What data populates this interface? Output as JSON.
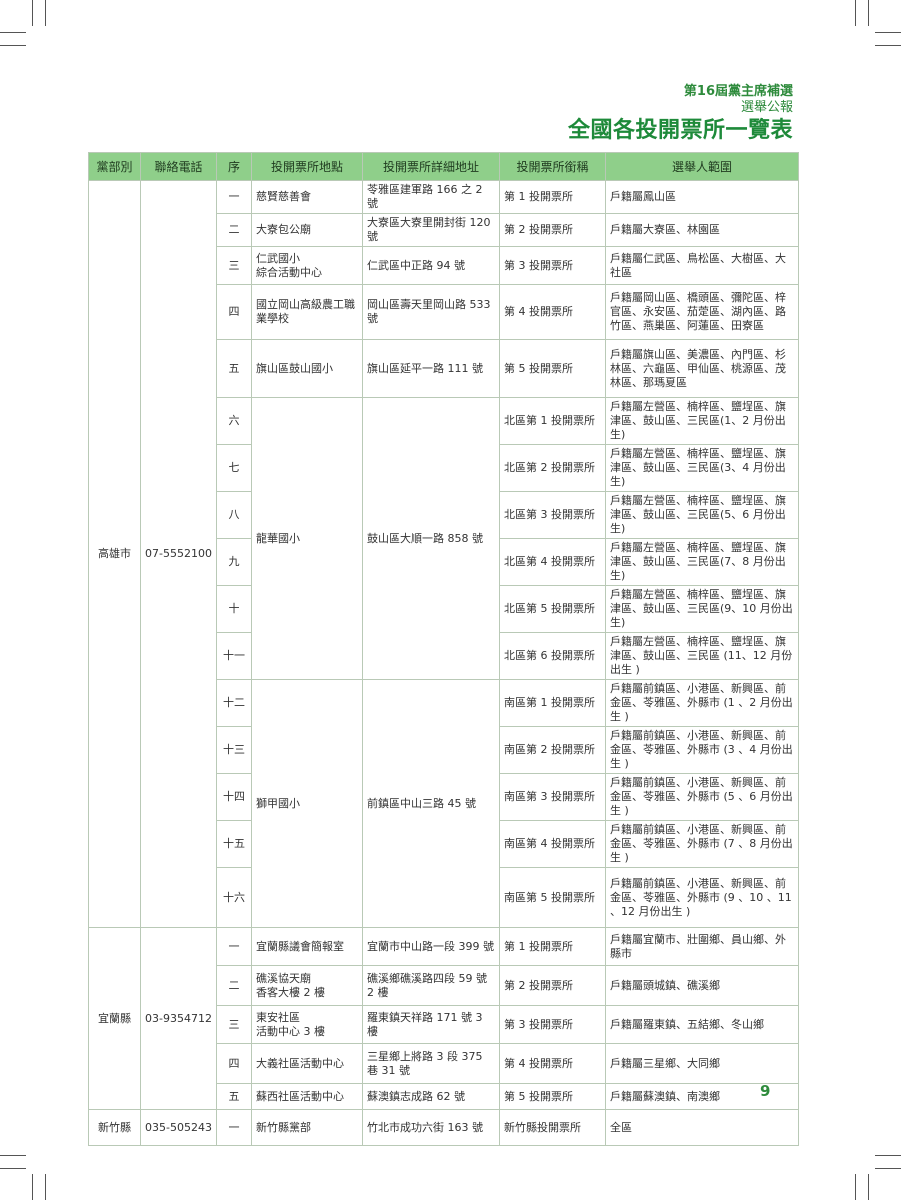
{
  "header": {
    "line1": "第16屆黨主席補選",
    "line2": "選舉公報",
    "title": "全國各投開票所一覽表"
  },
  "table": {
    "columns": [
      "黨部別",
      "聯絡電話",
      "序",
      "投開票所地點",
      "投開票所詳細地址",
      "投開票所銜稱",
      "選舉人範圍"
    ],
    "groups": [
      {
        "party": "高雄市",
        "phone": "07-5552100",
        "rows": [
          {
            "seq": "一",
            "location": "慈賢慈善會",
            "address": "苓雅區建軍路 166 之 2 號",
            "station": "第 1 投開票所",
            "scope": "戶籍屬鳳山區"
          },
          {
            "seq": "二",
            "location": "大寮包公廟",
            "address": "大寮區大寮里開封街 120 號",
            "station": "第 2 投開票所",
            "scope": "戶籍屬大寮區、林園區"
          },
          {
            "seq": "三",
            "location": "仁武國小\n綜合活動中心",
            "address": "仁武區中正路 94 號",
            "station": "第 3 投開票所",
            "scope": "戶籍屬仁武區、鳥松區、大樹區、大社區"
          },
          {
            "seq": "四",
            "location": "國立岡山高級農工職業學校",
            "address": "岡山區壽天里岡山路 533 號",
            "station": "第 4 投開票所",
            "scope": "戶籍屬岡山區、橋頭區、彌陀區、梓官區、永安區、茄萣區、湖內區、路竹區、燕巢區、阿蓮區、田寮區"
          },
          {
            "seq": "五",
            "location": "旗山區鼓山國小",
            "address": "旗山區延平一路 111 號",
            "station": "第 5 投開票所",
            "scope": "戶籍屬旗山區、美濃區、內門區、杉林區、六龜區、甲仙區、桃源區、茂林區、那瑪夏區"
          },
          {
            "seq": "六",
            "station": "北區第 1 投開票所",
            "scope": "戶籍屬左營區、楠梓區、鹽埕區、旗津區、鼓山區、三民區(1、2 月份出生)"
          },
          {
            "seq": "七",
            "station": "北區第 2 投開票所",
            "scope": "戶籍屬左營區、楠梓區、鹽埕區、旗津區、鼓山區、三民區(3、4 月份出生)"
          },
          {
            "seq": "八",
            "station": "北區第 3 投開票所",
            "scope": "戶籍屬左營區、楠梓區、鹽埕區、旗津區、鼓山區、三民區(5、6 月份出生)"
          },
          {
            "seq": "九",
            "station": "北區第 4 投開票所",
            "scope": "戶籍屬左營區、楠梓區、鹽埕區、旗津區、鼓山區、三民區(7、8 月份出生)"
          },
          {
            "seq": "十",
            "station": "北區第 5 投開票所",
            "scope": "戶籍屬左營區、楠梓區、鹽埕區、旗津區、鼓山區、三民區(9、10 月份出生)"
          },
          {
            "seq": "十一",
            "station": "北區第 6 投開票所",
            "scope": "戶籍屬左營區、楠梓區、鹽埕區、旗津區、鼓山區、三民區 (11、12 月份出生 )"
          },
          {
            "seq": "十二",
            "station": "南區第 1 投開票所",
            "scope": "戶籍屬前鎮區、小港區、新興區、前金區、苓雅區、外縣市 (1 、2 月份出生 )"
          },
          {
            "seq": "十三",
            "station": "南區第 2 投開票所",
            "scope": "戶籍屬前鎮區、小港區、新興區、前金區、苓雅區、外縣市 (3 、4 月份出生 )"
          },
          {
            "seq": "十四",
            "station": "南區第 3 投開票所",
            "scope": "戶籍屬前鎮區、小港區、新興區、前金區、苓雅區、外縣市 (5 、6 月份出生 )"
          },
          {
            "seq": "十五",
            "station": "南區第 4 投開票所",
            "scope": "戶籍屬前鎮區、小港區、新興區、前金區、苓雅區、外縣市 (7 、8 月份出生 )"
          },
          {
            "seq": "十六",
            "station": "南區第 5 投開票所",
            "scope": "戶籍屬前鎮區、小港區、新興區、前金區、苓雅區、外縣市 (9 、10 、11 、12 月份出生 )"
          }
        ],
        "merged_north": {
          "location": "龍華國小",
          "address": "鼓山區大順一路 858 號"
        },
        "merged_south": {
          "location": "獅甲國小",
          "address": "前鎮區中山三路 45 號"
        }
      },
      {
        "party": "宜蘭縣",
        "phone": "03-9354712",
        "rows": [
          {
            "seq": "一",
            "location": "宜蘭縣議會簡報室",
            "address": "宜蘭市中山路一段 399 號",
            "station": "第 1 投開票所",
            "scope": "戶籍屬宜蘭市、壯圍鄉、員山鄉、外縣市"
          },
          {
            "seq": "二",
            "location": "礁溪協天廟\n香客大樓 2 樓",
            "address": "礁溪鄉礁溪路四段 59 號 2 樓",
            "station": "第 2 投開票所",
            "scope": "戶籍屬頭城鎮、礁溪鄉"
          },
          {
            "seq": "三",
            "location": "東安社區\n活動中心 3 樓",
            "address": "羅東鎮天祥路 171 號 3 樓",
            "station": "第 3 投開票所",
            "scope": "戶籍屬羅東鎮、五結鄉、冬山鄉"
          },
          {
            "seq": "四",
            "location": "大義社區活動中心",
            "address": "三星鄉上將路 3 段 375 巷 31 號",
            "station": "第 4 投開票所",
            "scope": "戶籍屬三星鄉、大同鄉"
          },
          {
            "seq": "五",
            "location": "蘇西社區活動中心",
            "address": "蘇澳鎮志成路 62 號",
            "station": "第 5 投開票所",
            "scope": "戶籍屬蘇澳鎮、南澳鄉"
          }
        ]
      },
      {
        "party": "新竹縣",
        "phone": "035-505243",
        "rows": [
          {
            "seq": "一",
            "location": "新竹縣黨部",
            "address": "竹北市成功六街 163 號",
            "station": "新竹縣投開票所",
            "scope": "全區"
          }
        ]
      }
    ]
  },
  "page_number": "9"
}
